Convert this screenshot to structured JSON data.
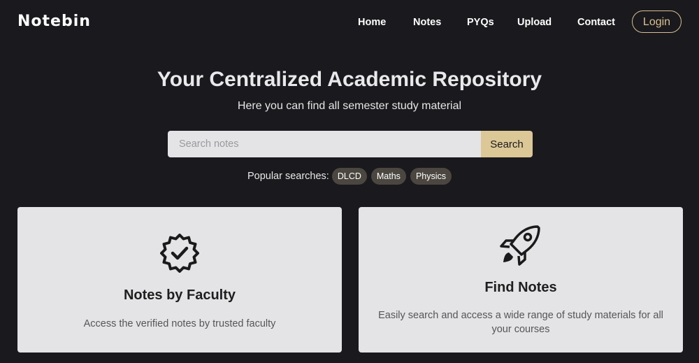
{
  "navbar": {
    "brand": "Notebin",
    "links": [
      "Home",
      "Notes",
      "PYQs",
      "Upload",
      "Contact"
    ],
    "login_label": "Login"
  },
  "hero": {
    "title": "Your Centralized Academic Repository",
    "subtitle": "Here you can find all semester study material"
  },
  "search": {
    "placeholder": "Search notes",
    "value": "",
    "button_label": "Search"
  },
  "popular": {
    "label": "Popular searches:",
    "tags": [
      "DLCD",
      "Maths",
      "Physics"
    ]
  },
  "cards": [
    {
      "icon": "verified-badge-icon",
      "title": "Notes by Faculty",
      "description": "Access the verified notes by trusted faculty"
    },
    {
      "icon": "rocket-icon",
      "title": "Find Notes",
      "description": "Easily search and access a wide range of study materials for all your courses"
    }
  ],
  "colors": {
    "background": "#1a191d",
    "accent": "#dcc797",
    "card": "#e4e3e6",
    "tag": "#4b4740"
  }
}
